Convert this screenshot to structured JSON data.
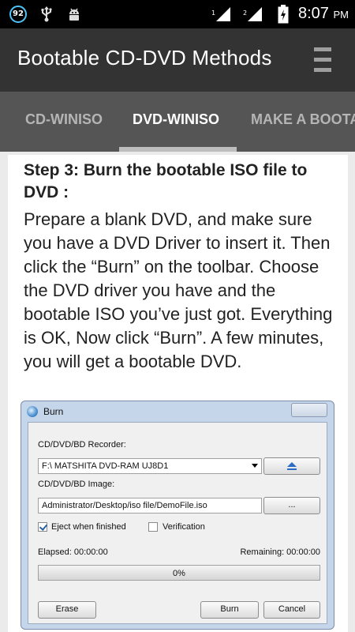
{
  "status_bar": {
    "notification_count": "92",
    "sim1": "1",
    "sim2": "2",
    "time": "8:07",
    "ampm": "PM"
  },
  "app_bar": {
    "title": "Bootable CD-DVD Methods",
    "menu_icon": "hamburger-menu-icon"
  },
  "tabs": [
    {
      "label": "CD-WINISO",
      "active": false
    },
    {
      "label": "DVD-WINISO",
      "active": true
    },
    {
      "label": "MAKE A BOOTA",
      "active": false
    }
  ],
  "content": {
    "step_title": "Step 3: Burn the bootable ISO file to DVD :",
    "body": "Prepare a blank DVD, and make sure you have a DVD Driver to insert it. Then click the “Burn” on the toolbar. Choose the DVD driver you have and the bootable ISO you’ve just got. Everything is OK, Now click “Burn”. A few minutes, you will get a bootable DVD."
  },
  "dialog": {
    "title": "Burn",
    "recorder_label": "CD/DVD/BD Recorder:",
    "recorder_value": "F:\\ MATSHITA  DVD-RAM UJ8D1",
    "image_label": "CD/DVD/BD Image:",
    "image_value": "Administrator/Desktop/iso file/DemoFile.iso",
    "browse_label": "...",
    "eject_label": "Eject when finished",
    "eject_checked": true,
    "verify_label": "Verification",
    "verify_checked": false,
    "elapsed": "Elapsed: 00:00:00",
    "remaining": "Remaining: 00:00:00",
    "progress_percent": 0,
    "progress_text": "0%",
    "erase_label": "Erase",
    "burn_label": "Burn",
    "cancel_label": "Cancel"
  }
}
